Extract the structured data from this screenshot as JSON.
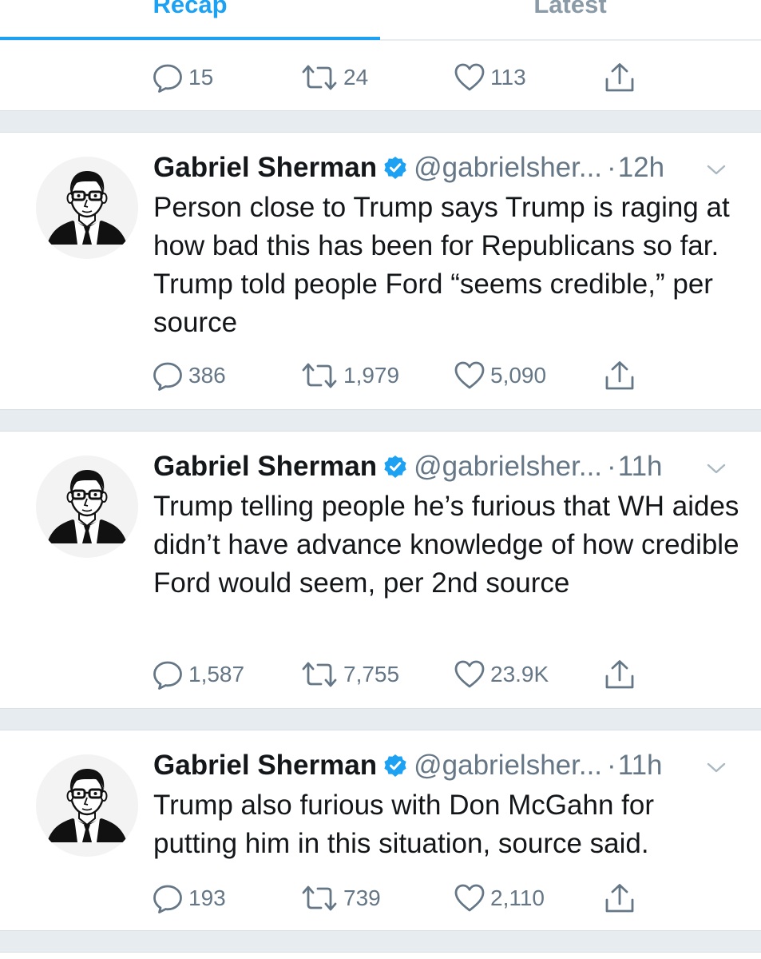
{
  "tabs": [
    {
      "label": "Recap",
      "active": true
    },
    {
      "label": "Latest",
      "active": false
    }
  ],
  "colors": {
    "accent": "#1da1f2",
    "text": "#14171a",
    "secondary": "#657786",
    "divider": "#e6ecf0"
  },
  "top_actions": {
    "replies": "15",
    "retweets": "24",
    "likes": "113"
  },
  "tweets": [
    {
      "name": "Gabriel Sherman",
      "verified": true,
      "handle": "@gabrielsher...",
      "separator": "·",
      "time": "12h",
      "text": "Person close to Trump says Trump is raging at how bad this has been for Republicans so far. Trump told people Ford “seems credible,” per source",
      "replies": "386",
      "retweets": "1,979",
      "likes": "5,090"
    },
    {
      "name": "Gabriel Sherman",
      "verified": true,
      "handle": "@gabrielsher...",
      "separator": "·",
      "time": "11h",
      "text": "Trump telling people he’s furious that WH aides didn’t have advance knowledge of how credible Ford would seem, per 2nd source",
      "replies": "1,587",
      "retweets": "7,755",
      "likes": "23.9K"
    },
    {
      "name": "Gabriel Sherman",
      "verified": true,
      "handle": "@gabrielsher...",
      "separator": "·",
      "time": "11h",
      "text": "Trump also furious with Don McGahn for putting him in this situation, source said.",
      "replies": "193",
      "retweets": "739",
      "likes": "2,110"
    }
  ]
}
